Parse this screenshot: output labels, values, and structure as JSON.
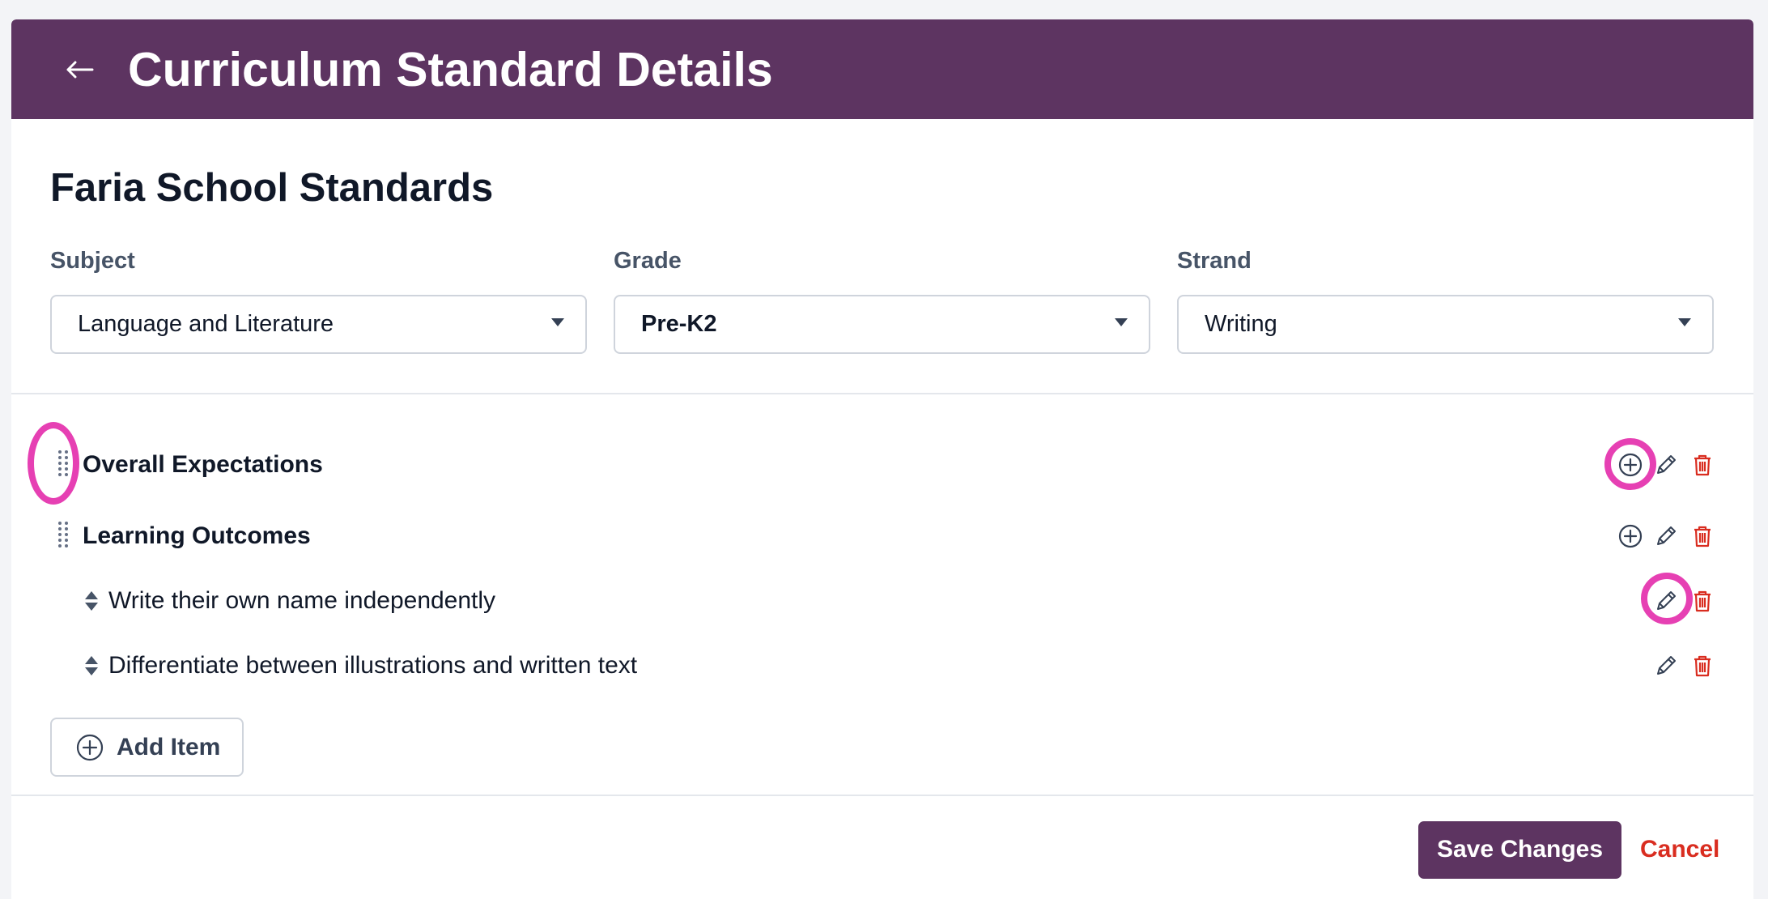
{
  "header": {
    "title": "Curriculum Standard Details",
    "back_icon": "arrow-left-icon",
    "color": "#5d3461"
  },
  "section_title": "Faria School Standards",
  "filters": {
    "subject": {
      "label": "Subject",
      "value": "Language and Literature"
    },
    "grade": {
      "label": "Grade",
      "value": "Pre-K2"
    },
    "strand": {
      "label": "Strand",
      "value": "Writing"
    }
  },
  "rows": [
    {
      "title": "Overall Expectations"
    },
    {
      "title": "Learning Outcomes"
    }
  ],
  "items": [
    {
      "text": "Write their own name independently"
    },
    {
      "text": "Differentiate between illustrations and written text"
    }
  ],
  "add_item": {
    "label": "Add Item",
    "icon": "plus-circle-icon"
  },
  "footer": {
    "save_label": "Save Changes",
    "cancel_label": "Cancel"
  },
  "icons": {
    "add": "plus-circle-icon",
    "edit": "pencil-icon",
    "delete": "trash-icon",
    "drag": "drag-handle-icon",
    "reorder": "sort-arrows-icon"
  },
  "colors": {
    "brand": "#5d3461",
    "danger": "#d92d20",
    "highlight": "#e640b3"
  }
}
